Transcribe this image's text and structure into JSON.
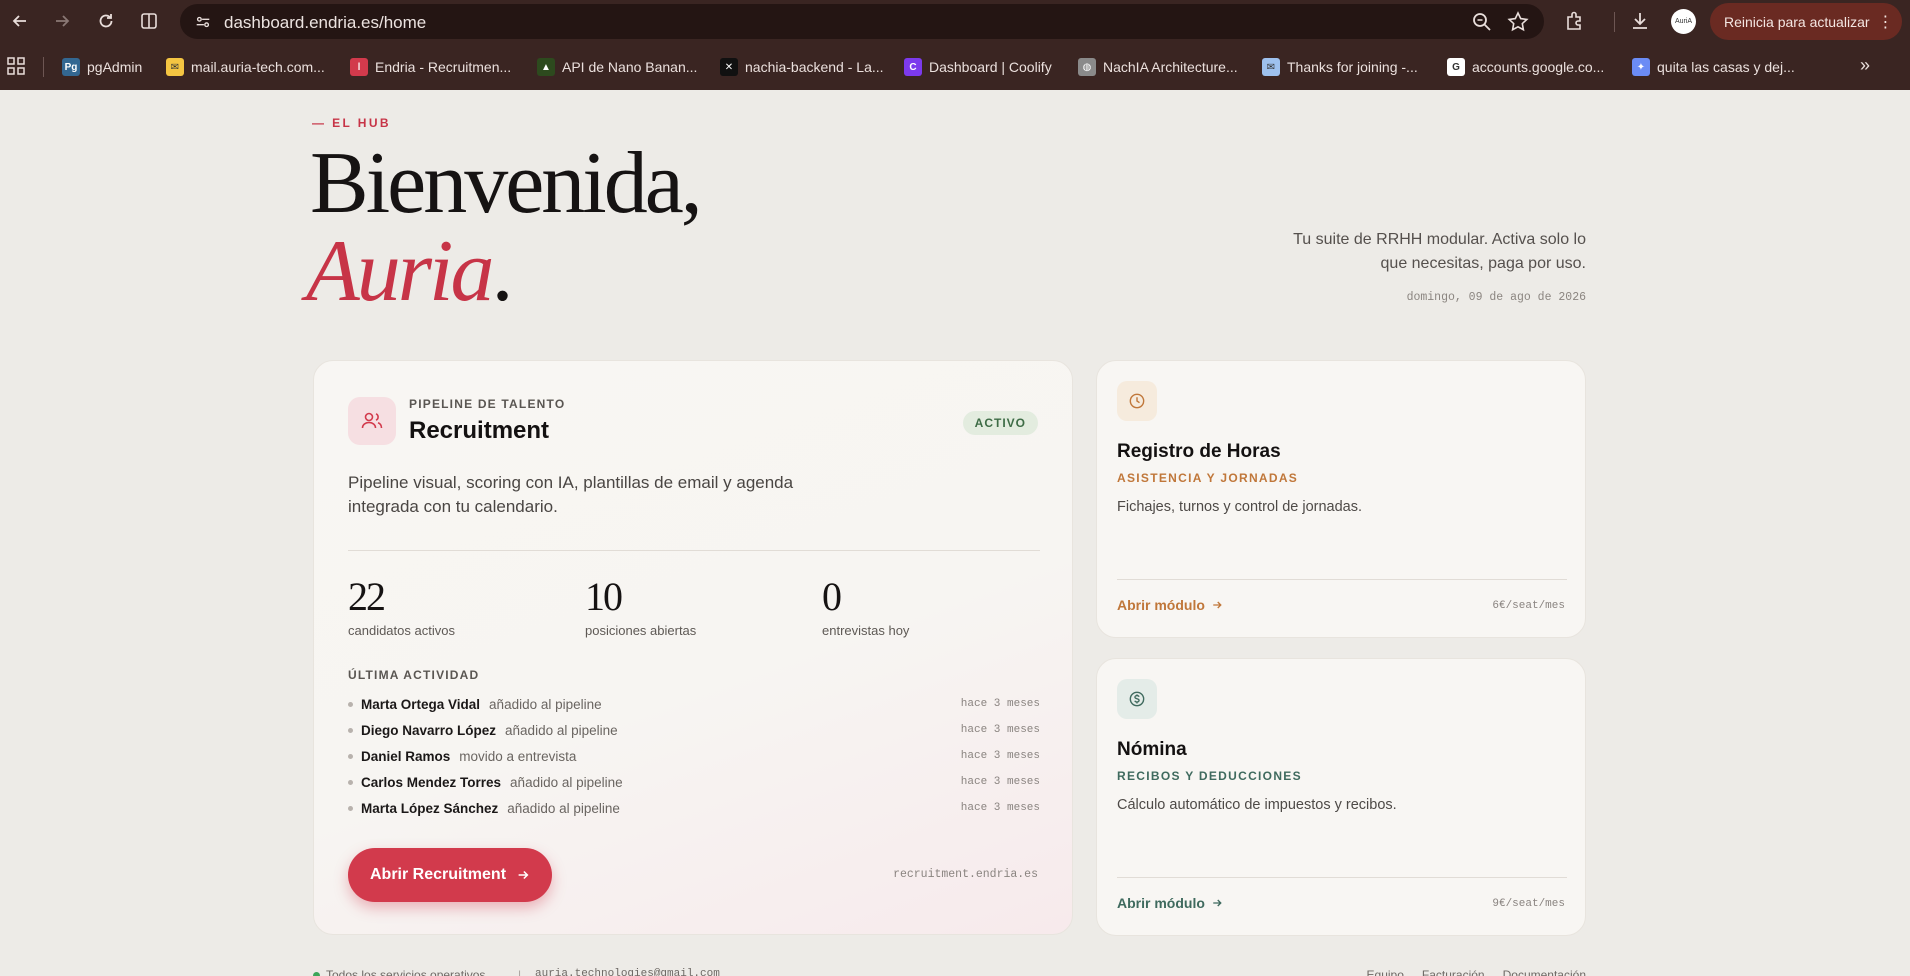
{
  "browser": {
    "url": "dashboard.endria.es/home",
    "update_button": "Reinicia para actualizar",
    "avatar_text": "AuriA",
    "bookmarks": [
      {
        "label": "pgAdmin",
        "icon": "pgadmin-icon",
        "color": "#336791",
        "glyph": "Pg"
      },
      {
        "label": "mail.auria-tech.com...",
        "icon": "mail-icon",
        "color": "#f4c542",
        "glyph": "✉"
      },
      {
        "label": "Endria - Recruitmen...",
        "icon": "endria-icon",
        "color": "#d23a4c",
        "glyph": "ǀ"
      },
      {
        "label": "API de Nano Banan...",
        "icon": "nano-banana-icon",
        "color": "#2d4a1e",
        "glyph": "▲"
      },
      {
        "label": "nachia-backend - La...",
        "icon": "nachia-icon",
        "color": "#111111",
        "glyph": "✕"
      },
      {
        "label": "Dashboard | Coolify",
        "icon": "coolify-icon",
        "color": "#7c3aed",
        "glyph": "C"
      },
      {
        "label": "NachIA Architecture...",
        "icon": "globe-icon",
        "color": "#8a8a8a",
        "glyph": "◍"
      },
      {
        "label": "Thanks for joining -...",
        "icon": "envelope-icon",
        "color": "#9ec1ee",
        "glyph": "✉"
      },
      {
        "label": "accounts.google.co...",
        "icon": "google-icon",
        "color": "#ffffff",
        "glyph": "G"
      },
      {
        "label": "quita las casas y dej...",
        "icon": "gemini-icon",
        "color": "#6b8cf5",
        "glyph": "✦"
      }
    ]
  },
  "hero": {
    "eyebrow": "— EL HUB",
    "line1": "Bienvenida,",
    "line2": "Auria",
    "line2_dot": ".",
    "tagline": "Tu suite de RRHH modular. Activa solo lo que necesitas, paga por uso.",
    "date": "domingo, 09 de ago de 2026"
  },
  "recruitment": {
    "kicker": "PIPELINE DE TALENTO",
    "title": "Recruitment",
    "badge": "ACTIVO",
    "description": "Pipeline visual, scoring con IA, plantillas de email y agenda integrada con tu calendario.",
    "stats": [
      {
        "value": "22",
        "label": "candidatos activos"
      },
      {
        "value": "10",
        "label": "posiciones abiertas"
      },
      {
        "value": "0",
        "label": "entrevistas hoy"
      }
    ],
    "activity_title": "ÚLTIMA ACTIVIDAD",
    "activity": [
      {
        "name": "Marta Ortega Vidal",
        "action": "añadido al pipeline",
        "time": "hace 3 meses"
      },
      {
        "name": "Diego Navarro López",
        "action": "añadido al pipeline",
        "time": "hace 3 meses"
      },
      {
        "name": "Daniel Ramos",
        "action": "movido a entrevista",
        "time": "hace 3 meses"
      },
      {
        "name": "Carlos Mendez Torres",
        "action": "añadido al pipeline",
        "time": "hace 3 meses"
      },
      {
        "name": "Marta López Sánchez",
        "action": "añadido al pipeline",
        "time": "hace 3 meses"
      }
    ],
    "cta": "Abrir Recruitment",
    "subdomain": "recruitment.endria.es",
    "accent": "#d23a4c"
  },
  "modules": [
    {
      "title": "Registro de Horas",
      "subtitle": "ASISTENCIA Y JORNADAS",
      "description": "Fichajes, turnos y control de jornadas.",
      "link": "Abrir módulo",
      "price": "6€/seat/mes",
      "icon": "clock-icon",
      "accent": "#c0773a",
      "icon_bg": "#f6ebdd"
    },
    {
      "title": "Nómina",
      "subtitle": "RECIBOS Y DEDUCCIONES",
      "description": "Cálculo automático de impuestos y recibos.",
      "link": "Abrir módulo",
      "price": "9€/seat/mes",
      "icon": "dollar-icon",
      "accent": "#3f6a5e",
      "icon_bg": "#e4ece8"
    }
  ],
  "footer": {
    "status": "Todos los servicios operativos",
    "separator": "|",
    "email": "auria.technologies@gmail.com",
    "links": [
      "Equipo",
      "Facturación",
      "Documentación"
    ]
  }
}
